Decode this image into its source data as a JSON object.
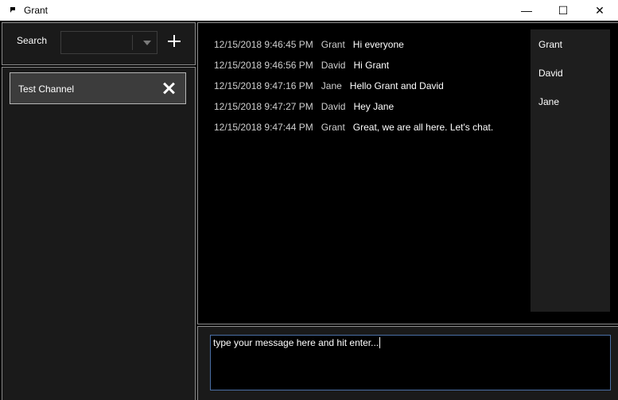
{
  "window": {
    "title": "Grant",
    "minimize_glyph": "—",
    "maximize_glyph": "☐",
    "close_glyph": "✕"
  },
  "search": {
    "label": "Search",
    "value": ""
  },
  "channels": [
    {
      "name": "Test Channel"
    }
  ],
  "messages": [
    {
      "time": "12/15/2018 9:46:45 PM",
      "user": "Grant",
      "text": "Hi everyone"
    },
    {
      "time": "12/15/2018 9:46:56 PM",
      "user": "David",
      "text": "Hi Grant"
    },
    {
      "time": "12/15/2018 9:47:16 PM",
      "user": "Jane",
      "text": "Hello Grant and David"
    },
    {
      "time": "12/15/2018 9:47:27 PM",
      "user": "David",
      "text": "Hey Jane"
    },
    {
      "time": "12/15/2018 9:47:44 PM",
      "user": "Grant",
      "text": "Great, we are all here. Let's chat."
    }
  ],
  "users": [
    "Grant",
    "David",
    "Jane"
  ],
  "composer": {
    "value": "type your message here and hit enter..."
  },
  "colors": {
    "background": "#000000",
    "panel": "#1a1a1a",
    "border": "#8c8c8c",
    "input_focus": "#4a6fa5"
  }
}
